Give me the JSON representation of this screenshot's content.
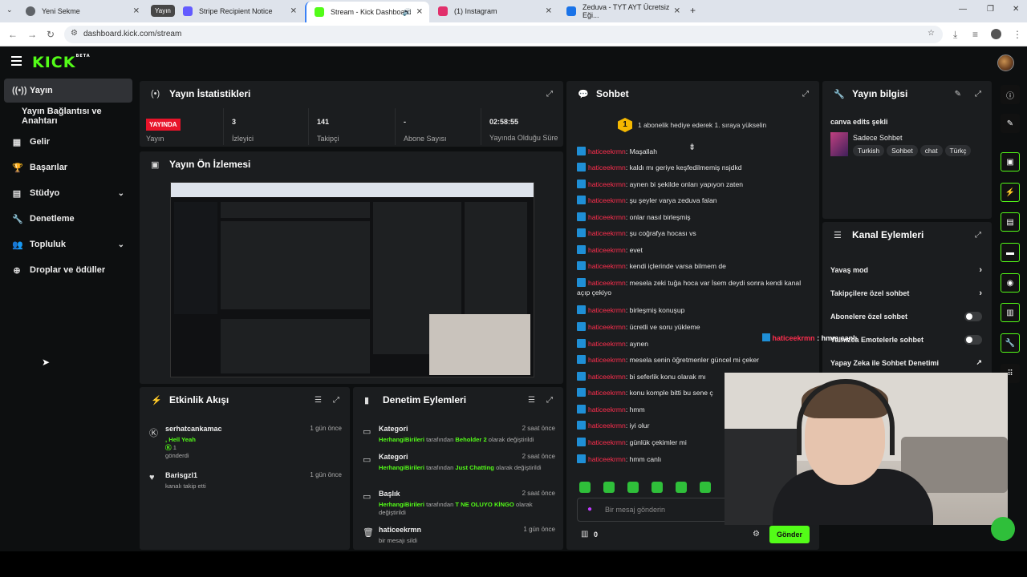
{
  "browser": {
    "tabs": [
      {
        "label": "Yeni Sekme",
        "color": "#5f6368"
      },
      {
        "label": "Stripe Recipient Notice",
        "color": "#635bff"
      },
      {
        "label": "Stream - Kick Dashboard",
        "color": "#53fc18"
      },
      {
        "label": "(1) Instagram",
        "color": "#e1306c"
      },
      {
        "label": "Zeduva - TYT AYT Ücretsiz Eği...",
        "color": "#1a73e8"
      }
    ],
    "tab_group_label": "Yayın",
    "url": "dashboard.kick.com/stream"
  },
  "app": {
    "logo": "KICK",
    "logo_badge": "BETA"
  },
  "sidebar": {
    "items": [
      {
        "label": "Yayın",
        "icon": "broadcast-icon"
      },
      {
        "label": "Yayın Bağlantısı ve Anahtarı",
        "icon": ""
      },
      {
        "label": "Gelir",
        "icon": "revenue-icon"
      },
      {
        "label": "Başarılar",
        "icon": "trophy-icon"
      },
      {
        "label": "Stüdyo",
        "icon": "studio-icon"
      },
      {
        "label": "Denetleme",
        "icon": "wrench-icon"
      },
      {
        "label": "Topluluk",
        "icon": "community-icon"
      },
      {
        "label": "Droplar ve ödüller",
        "icon": "drops-icon"
      }
    ]
  },
  "stats": {
    "title": "Yayın İstatistikleri",
    "live_badge": "YAYINDA",
    "live_label": "Yayın",
    "viewers_value": "3",
    "viewers_label": "İzleyici",
    "followers_value": "141",
    "followers_label": "Takipçi",
    "subs_value": "-",
    "subs_label": "Abone Sayısı",
    "uptime_value": "02:58:55",
    "uptime_label": "Yayında Olduğu Süre"
  },
  "preview": {
    "title": "Yayın Ön İzlemesi"
  },
  "activity": {
    "title": "Etkinlik Akışı",
    "items": [
      {
        "name": "serhatcankamac",
        "time": "1 gün önce",
        "line1": ", Hell Yeah",
        "line2": "1",
        "line3": "gönderdi"
      },
      {
        "name": "Barisgzl1",
        "time": "1 gün önce",
        "line1": "kanalı takip etti"
      }
    ]
  },
  "moderation": {
    "title": "Denetim Eylemleri",
    "items": [
      {
        "title": "Kategori",
        "time": "2 saat önce",
        "actor": "HerhangiBirileri",
        "mid": "tarafından",
        "value": "Beholder 2",
        "end": "olarak değiştirildi"
      },
      {
        "title": "Kategori",
        "time": "2 saat önce",
        "actor": "HerhangiBirileri",
        "mid": "tarafından",
        "value": "Just Chatting",
        "end": "olarak değiştirildi"
      },
      {
        "title": "Başlık",
        "time": "2 saat önce",
        "actor": "HerhangiBirileri",
        "mid": "tarafından",
        "value": "T NE OLUYO KİNGO",
        "end": "olarak değiştirildi"
      },
      {
        "title": "haticeekrmn",
        "time": "1 gün önce",
        "actor": "",
        "mid": "",
        "value": "",
        "end": "bir mesajı sildi"
      }
    ]
  },
  "chat": {
    "title": "Sohbet",
    "banner_rank": "1",
    "banner": "1 abonelik hediye ederek 1. sıraya yükselin",
    "username": "haticeekrmn",
    "messages": [
      "Maşallah",
      "kaldı mı geriye keşfedilmemiş nsjdkd",
      "aynen bi şekilde onları yapıyon zaten",
      "şu şeyler varya zeduva falan",
      "onlar nasıl birleşmiş",
      "şu coğrafya hocası vs",
      "evet",
      "kendi içlerinde varsa bilmem de",
      "mesela zeki tuğa hoca var İsem deydi sonra kendi kanal açıp çekiyo",
      "birleşmiş konuşup",
      "ücretli ve soru yükleme",
      "aynen",
      "mesela senin öğretmenler güncel mi çeker",
      "bi seferlik konu olarak mı",
      "konu komple bitti bu sene ç",
      "hmm",
      "iyi olur",
      "günlük çekimler mi",
      "hmm canlı"
    ],
    "input_placeholder": "Bir mesaj gönderin",
    "points": "0",
    "send_label": "Gönder",
    "overlay_text": "hmm canlı"
  },
  "info": {
    "title": "Yayın bilgisi",
    "stream_title": "canva edits şekli",
    "category": "Sadece Sohbet",
    "tags": [
      "Turkish",
      "Sohbet",
      "chat",
      "Türkç"
    ]
  },
  "channel": {
    "title": "Kanal Eylemleri",
    "items": [
      {
        "label": "Yavaş mod",
        "kind": "chevron"
      },
      {
        "label": "Takipçilere özel sohbet",
        "kind": "chevron"
      },
      {
        "label": "Abonelere özel sohbet",
        "kind": "toggle"
      },
      {
        "label": "Yalnızca Emotelerle sohbet",
        "kind": "toggle"
      },
      {
        "label": "Yapay Zeka ile Sohbet Denetimi",
        "kind": "link"
      }
    ]
  },
  "colors": {
    "accent": "#53fc18",
    "live": "#e8142a",
    "chat_user": "#ff2e4e"
  }
}
